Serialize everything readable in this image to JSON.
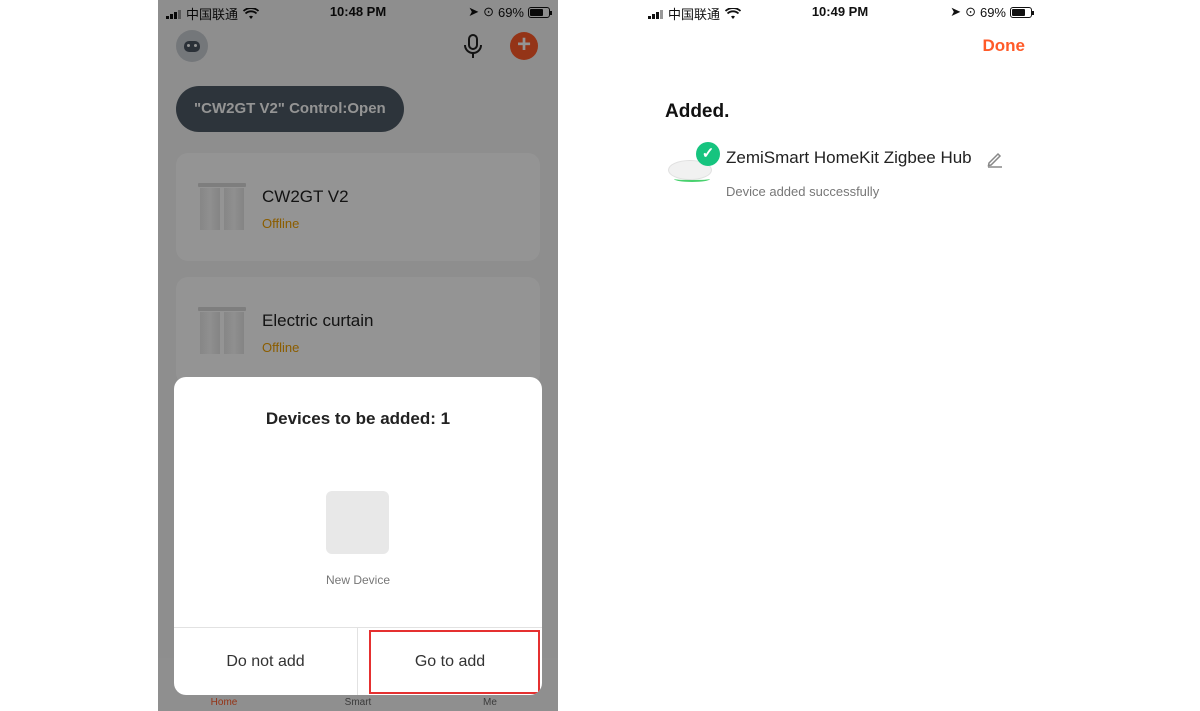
{
  "left_screen": {
    "status_bar": {
      "carrier": "中国联通",
      "time": "10:48 PM",
      "battery": "69%"
    },
    "scene_chip": "\"CW2GT V2\" Control:Open",
    "devices": [
      {
        "name": "CW2GT V2",
        "status": "Offline"
      },
      {
        "name": "Electric curtain",
        "status": "Offline"
      }
    ],
    "modal": {
      "title": "Devices to be added: 1",
      "device_label": "New Device",
      "cancel_label": "Do not add",
      "confirm_label": "Go to add"
    },
    "tabs": {
      "home": "Home",
      "smart": "Smart",
      "me": "Me"
    }
  },
  "right_screen": {
    "status_bar": {
      "carrier": "中国联通",
      "time": "10:49 PM",
      "battery": "69%"
    },
    "done_label": "Done",
    "section_title": "Added.",
    "added_device": {
      "name": "ZemiSmart HomeKit Zigbee Hub",
      "status": "Device added successfully"
    }
  },
  "colors": {
    "accent": "#ff5a28",
    "offline": "#f0a000",
    "success": "#16c47f",
    "highlight": "#e53030"
  }
}
